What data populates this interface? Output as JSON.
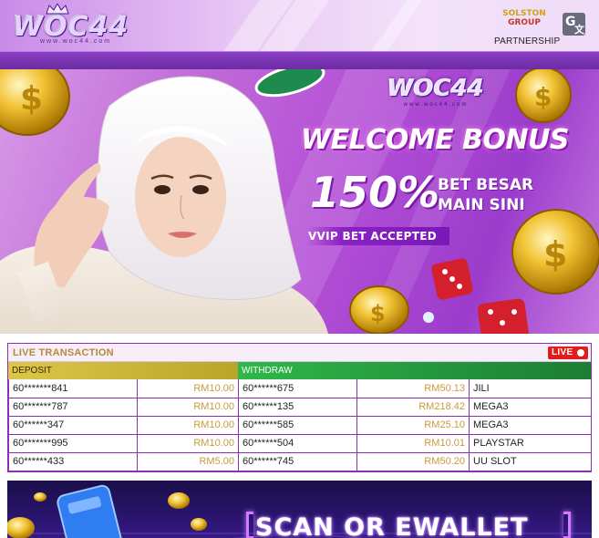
{
  "header": {
    "logo_text": "WOC44",
    "logo_sub": "www.woc44.com",
    "partner_brand_top": "SOLSTON",
    "partner_brand_group": "GROUP",
    "partner_label": "PARTNERSHIP",
    "lang_icon": "google-translate-icon"
  },
  "banner": {
    "logo_text": "WOC44",
    "logo_sub": "www.woc44.com",
    "headline": "WELCOME BONUS",
    "percent": "150%",
    "bet_line1": "BET BESAR",
    "bet_line2": "MAIN SINI",
    "tag": "VVIP BET ACCEPTED"
  },
  "live": {
    "title": "LIVE TRANSACTION",
    "badge": "LIVE",
    "deposit_label": "DEPOSIT",
    "withdraw_label": "WITHDRAW",
    "rows": [
      {
        "dep_acc": "60*******841",
        "dep_amt": "RM10.00",
        "wd_acc": "60******675",
        "wd_amt": "RM50.13",
        "game": "JILI"
      },
      {
        "dep_acc": "60*******787",
        "dep_amt": "RM10.00",
        "wd_acc": "60******135",
        "wd_amt": "RM218.42",
        "game": "MEGA3"
      },
      {
        "dep_acc": "60******347",
        "dep_amt": "RM10.00",
        "wd_acc": "60******585",
        "wd_amt": "RM25.10",
        "game": "MEGA3"
      },
      {
        "dep_acc": "60*******995",
        "dep_amt": "RM10.00",
        "wd_acc": "60******504",
        "wd_amt": "RM10.01",
        "game": "PLAYSTAR"
      },
      {
        "dep_acc": "60******433",
        "dep_amt": "RM5.00",
        "wd_acc": "60******745",
        "wd_amt": "RM50.20",
        "game": "UU SLOT"
      }
    ]
  },
  "promo": {
    "headline": "SCAN OR EWALLET"
  },
  "colors": {
    "accent_purple": "#8c2fb4",
    "deposit_gold": "#c8b53a",
    "withdraw_green": "#2a9a40",
    "live_red": "#e21b1b"
  }
}
